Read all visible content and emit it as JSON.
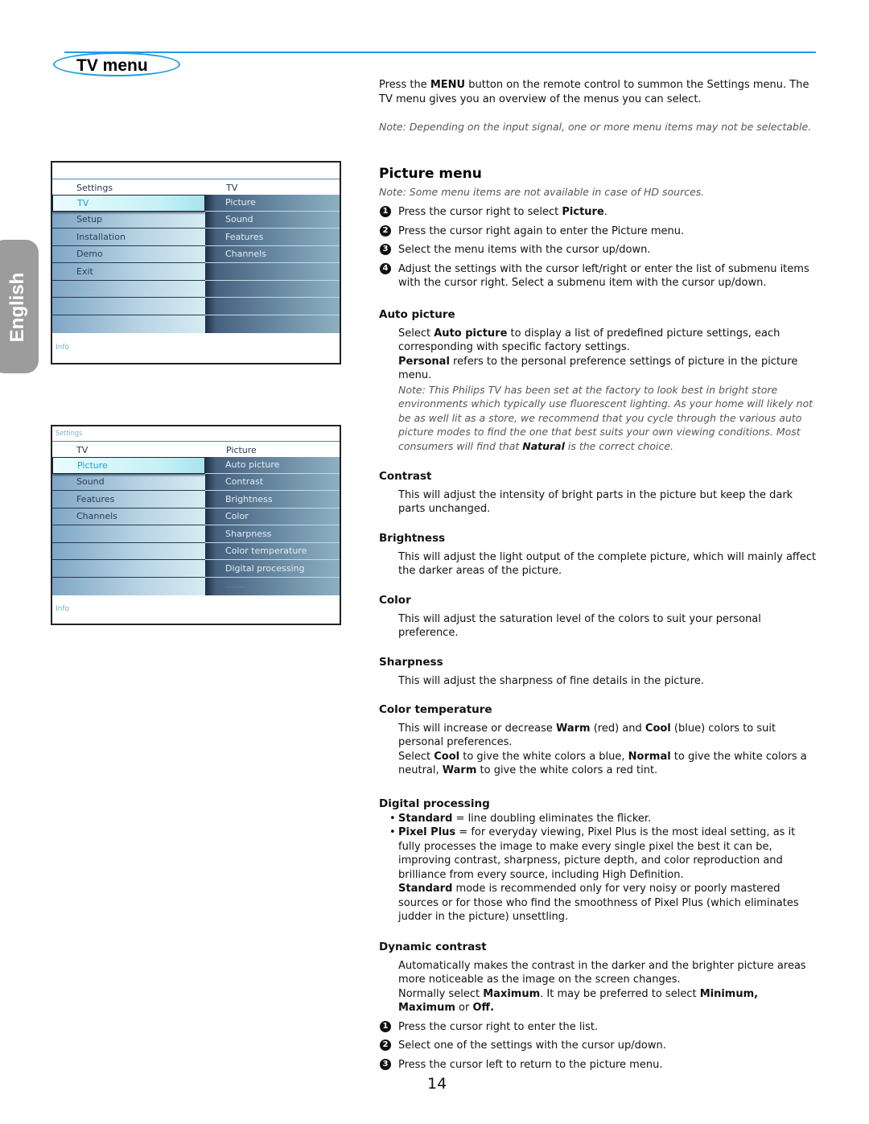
{
  "header": {
    "title": "TV menu"
  },
  "side_tab": {
    "language": "English"
  },
  "screens": [
    {
      "crumb": "",
      "left_header": "Settings",
      "right_header": "TV",
      "left_items": [
        "TV",
        "Setup",
        "Installation",
        "Demo",
        "Exit",
        "......",
        "",
        ""
      ],
      "selected_index": 0,
      "right_items": [
        "Picture",
        "Sound",
        "Features",
        "Channels",
        "",
        "",
        "",
        ""
      ],
      "info": "Info"
    },
    {
      "crumb": "Settings",
      "left_header": "TV",
      "right_header": "Picture",
      "left_items": [
        "Picture",
        "Sound",
        "Features",
        "Channels",
        "",
        "",
        "",
        ""
      ],
      "selected_index": 0,
      "right_items": [
        "Auto picture",
        "Contrast",
        "Brightness",
        "Color",
        "Sharpness",
        "Color temperature",
        "Digital processing",
        "......."
      ],
      "info": "Info"
    }
  ],
  "intro": {
    "p1_pre": "Press the ",
    "p1_bold": "MENU",
    "p1_post": " button on the remote control to summon the Settings menu. The TV menu gives you an overview of the menus you can select.",
    "note": "Note: Depending on the input signal, one or more menu items may not be selectable."
  },
  "picture_menu": {
    "title": "Picture menu",
    "note": "Note: Some menu items are not available in case of HD sources.",
    "steps": [
      {
        "num": "1",
        "pre": "Press the cursor right to select ",
        "bold": "Picture",
        "post": "."
      },
      {
        "num": "2",
        "pre": "Press the cursor right again to enter the Picture menu.",
        "bold": "",
        "post": ""
      },
      {
        "num": "3",
        "pre": "Select the menu items with the cursor up/down.",
        "bold": "",
        "post": ""
      },
      {
        "num": "4",
        "pre": "Adjust the settings with the cursor left/right or enter the list of submenu items with the cursor right. Select a submenu item with the cursor up/down.",
        "bold": "",
        "post": ""
      }
    ]
  },
  "sections": {
    "auto_picture": {
      "title": "Auto picture",
      "l1_pre": "Select ",
      "l1_bold": "Auto picture",
      "l1_post": " to display a list of predefined picture settings, each corresponding with specific factory settings.",
      "l2_bold": "Personal",
      "l2_post": " refers to the personal preference settings of picture in the picture menu.",
      "note_pre": "Note: This Philips TV has been set at the factory to look best in bright store environments which typically use fluorescent lighting. As your home will likely not be as well lit as a store, we recommend that you cycle through the various auto picture modes to find the one that best suits your own viewing conditions. Most consumers will find that ",
      "note_bold": "Natural",
      "note_post": " is the correct choice."
    },
    "contrast": {
      "title": "Contrast",
      "text": "This will adjust the intensity of bright parts in the picture but keep the dark parts unchanged."
    },
    "brightness": {
      "title": "Brightness",
      "text": "This will adjust the light output of the complete picture, which will mainly affect the darker areas of the picture."
    },
    "color": {
      "title": "Color",
      "text": "This will adjust the saturation level of the colors to suit your personal preference."
    },
    "sharpness": {
      "title": "Sharpness",
      "text": "This will adjust the sharpness of fine details in the picture."
    },
    "color_temperature": {
      "title": "Color temperature",
      "l1_a": "This will increase or decrease ",
      "l1_b": "Warm",
      "l1_c": " (red) and ",
      "l1_d": "Cool",
      "l1_e": " (blue) colors to suit personal preferences.",
      "l2_a": "Select ",
      "l2_b": "Cool",
      "l2_c": " to give the white colors a blue, ",
      "l2_d": "Normal",
      "l2_e": " to give the white colors a neutral, ",
      "l2_f": "Warm",
      "l2_g": " to give the white colors a red tint."
    },
    "digital_processing": {
      "title": "Digital processing",
      "b1_bold": "Standard",
      "b1_text": " = line doubling eliminates the flicker.",
      "b2_bold": "Pixel Plus",
      "b2_text": " = for everyday viewing, Pixel Plus is the most ideal setting, as it fully processes the image to make every single pixel the best it can be, improving contrast, sharpness, picture depth, and color reproduction and brilliance from every source, including High Definition.",
      "p_bold": "Standard",
      "p_text": " mode is recommended only for very noisy or poorly mastered sources or for those who find the smoothness of Pixel Plus (which eliminates judder in the picture) unsettling."
    },
    "dynamic_contrast": {
      "title": "Dynamic contrast",
      "text": "Automatically makes the contrast in the darker and the brighter picture areas more noticeable as the image on the screen changes.",
      "l2_a": "Normally select ",
      "l2_b": "Maximum",
      "l2_c": ". It may be preferred to select ",
      "l2_d": "Minimum, Maximum",
      "l2_e": " or ",
      "l2_f": "Off.",
      "steps": [
        {
          "num": "1",
          "text": "Press the cursor right to enter the list."
        },
        {
          "num": "2",
          "text": "Select one of the settings with the cursor up/down."
        },
        {
          "num": "3",
          "text": "Press the cursor left to return to the picture menu."
        }
      ]
    }
  },
  "footer": {
    "page_number": "14"
  },
  "colors": {
    "accent": "#1e9be8",
    "side_tab": "#9c9c9c"
  }
}
